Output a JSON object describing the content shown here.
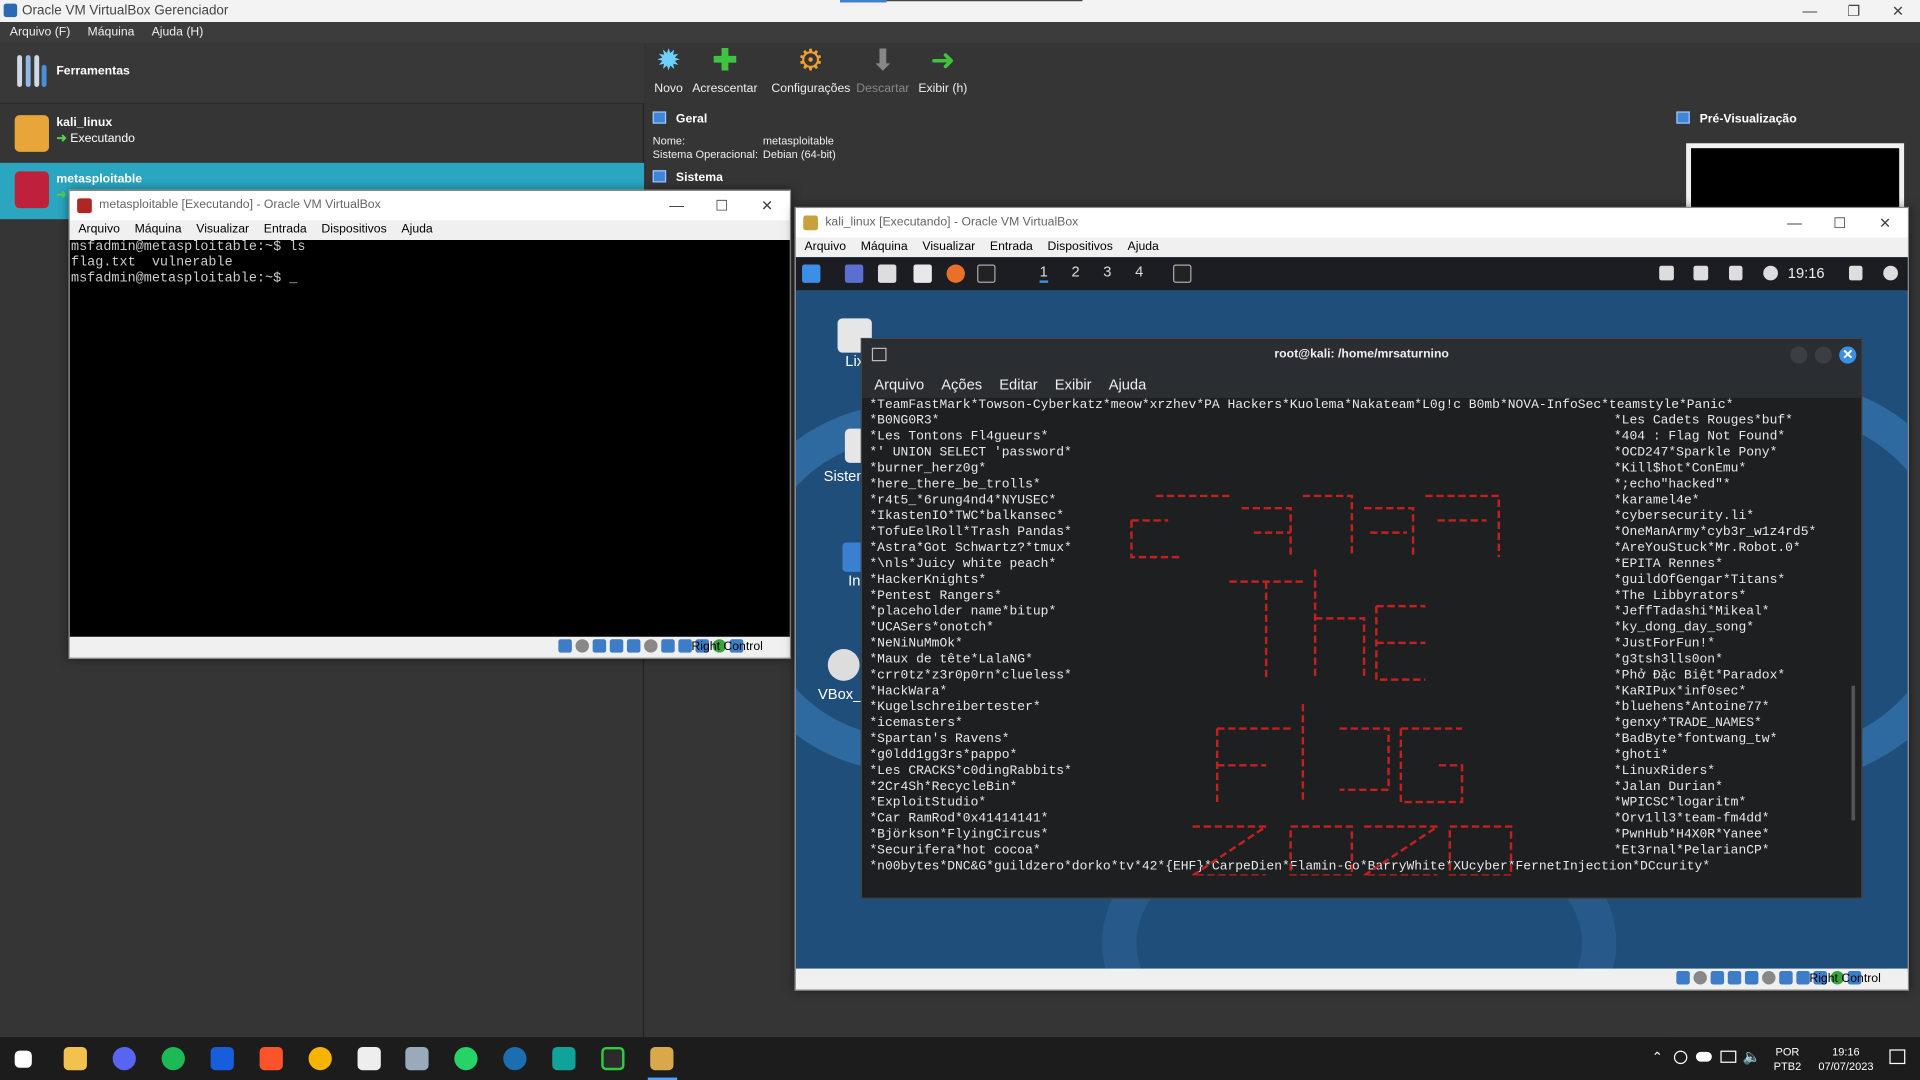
{
  "manager": {
    "title": "Oracle VM VirtualBox Gerenciador",
    "menu": [
      "Arquivo (F)",
      "Máquina",
      "Ajuda (H)"
    ],
    "tools_label": "Ferramentas",
    "vms": [
      {
        "name": "kali_linux",
        "state": "Executando"
      },
      {
        "name": "metasploitable",
        "state": "Executando"
      }
    ],
    "toolbar": [
      {
        "label": "Novo",
        "icon": "new-icon"
      },
      {
        "label": "Acrescentar",
        "icon": "add-icon"
      },
      {
        "label": "Configurações",
        "icon": "settings-gear-icon"
      },
      {
        "label": "Descartar",
        "icon": "discard-arrow-icon",
        "disabled": true
      },
      {
        "label": "Exibir (h)",
        "icon": "show-arrow-icon"
      }
    ],
    "general_header": "Geral",
    "general": {
      "name_key": "Nome:",
      "name_val": "metasploitable",
      "os_key": "Sistema Operacional:",
      "os_val": "Debian (64-bit)"
    },
    "system_header": "Sistema",
    "preview_header": "Pré-Visualização"
  },
  "meta_window": {
    "title": "metasploitable [Executando] - Oracle VM VirtualBox",
    "menu": [
      "Arquivo",
      "Máquina",
      "Visualizar",
      "Entrada",
      "Dispositivos",
      "Ajuda"
    ],
    "console": "msfadmin@metasploitable:~$ ls\nflag.txt  vulnerable\nmsfadmin@metasploitable:~$ _",
    "host_key": "Right Control"
  },
  "kali_window": {
    "title": "kali_linux [Executando] - Oracle VM VirtualBox",
    "menu": [
      "Arquivo",
      "Máquina",
      "Visualizar",
      "Entrada",
      "Dispositivos",
      "Ajuda"
    ],
    "workspaces": [
      "1",
      "2",
      "3",
      "4"
    ],
    "clock": "19:16",
    "host_key": "Right Control",
    "desktop_icons": [
      "Lix",
      "Sistem",
      "Ini",
      "VBox_"
    ],
    "terminal": {
      "title": "root@kali: /home/mrsaturnino",
      "menu": [
        "Arquivo",
        "Ações",
        "Editar",
        "Exibir",
        "Ajuda"
      ],
      "first_line": "*TeamFastMark*Towson-Cyberkatz*meow*xrzhev*PA Hackers*Kuolema*Nakateam*L0g!c B0mb*NOVA-InfoSec*teamstyle*Panic*",
      "last_line": "*n00bytes*DNC&G*guildzero*dorko*tv*42*{EHF}*CarpeDien*Flamin-Go*BarryWhite*XUcyber*FernetInjection*DCcurity*",
      "left": [
        "*B0NG0R3*",
        "*Les Tontons Fl4gueurs*",
        "*' UNION SELECT 'password*",
        "*burner_herz0g*",
        "*here_there_be_trolls*",
        "*r4t5_*6rung4nd4*NYUSEC*",
        "*IkastenIO*TWC*balkansec*",
        "*TofuEelRoll*Trash Pandas*",
        "*Astra*Got Schwartz?*tmux*",
        "*\\nls*Juicy white peach*",
        "*HackerKnights*",
        "*Pentest Rangers*",
        "*placeholder name*bitup*",
        "*UCASers*onotch*",
        "*NeNiNuMmOk*",
        "*Maux de tête*LalaNG*",
        "*crr0tz*z3r0p0rn*clueless*",
        "*HackWara*",
        "*Kugelschreibertester*",
        "*icemasters*",
        "*Spartan's Ravens*",
        "*g0ldd1gg3rs*pappo*",
        "*Les CRACKS*c0dingRabbits*",
        "*2Cr4Sh*RecycleBin*",
        "*ExploitStudio*",
        "*Car RamRod*0x41414141*",
        "*Björkson*FlyingCircus*",
        "*Securifera*hot cocoa*"
      ],
      "right": [
        "*Les Cadets Rouges*buf*",
        "*404 : Flag Not Found*",
        "*OCD247*Sparkle Pony*",
        "*Kill$hot*ConEmu*",
        "*;echo\"hacked\"*",
        "*karamel4e*",
        "*cybersecurity.li*",
        "*OneManArmy*cyb3r_w1z4rd5*",
        "*AreYouStuck*Mr.Robot.0*",
        "*EPITA Rennes*",
        "*guildOfGengar*Titans*",
        "*The Libbyrators*",
        "*JeffTadashi*Mikeal*",
        "*ky_dong_day_song*",
        "*JustForFun!*",
        "*g3tsh3lls0on*",
        "*Phở Đặc Biệt*Paradox*",
        "*KaRIPux*inf0sec*",
        "*bluehens*Antoine77*",
        "*genxy*TRADE_NAMES*",
        "*BadByte*fontwang_tw*",
        "*ghoti*",
        "*LinuxRiders*",
        "*Jalan Durian*",
        "*WPICSC*logaritm*",
        "*Orv1ll3*team-fm4dd*",
        "*PwnHub*H4X0R*Yanee*",
        "*Et3rnal*PelarianCP*"
      ]
    }
  },
  "taskbar": {
    "apps": [
      "windows-start-icon",
      "file-explorer-icon",
      "discord-icon",
      "spotify-icon",
      "bitwarden-icon",
      "brave-icon",
      "chrome-icon",
      "notion-icon",
      "virtualbox-cube-icon",
      "whatsapp-icon",
      "steam-icon",
      "game-icon",
      "wordpad-icon",
      "virtualbox-icon"
    ],
    "lang": "POR",
    "layout": "PTB2",
    "time": "19:16",
    "date": "07/07/2023"
  }
}
